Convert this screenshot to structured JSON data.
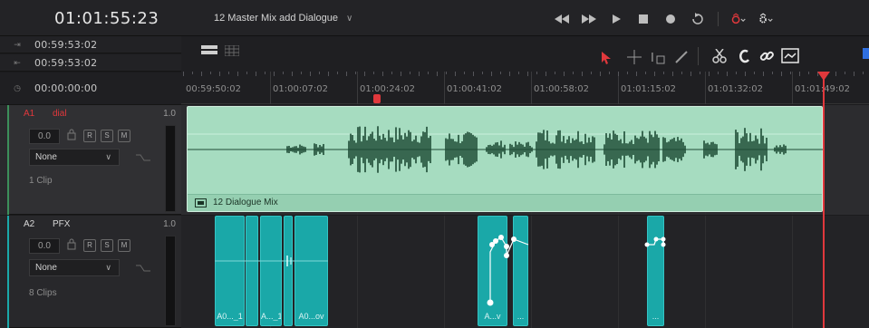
{
  "header": {
    "timecode": "01:01:55:23",
    "timeline_name": "12 Master Mix add Dialogue",
    "dropdown_glyph": "∨"
  },
  "timecodes": [
    {
      "icon": "⇥",
      "value": "00:59:53:02"
    },
    {
      "icon": "⇤",
      "value": "00:59:53:02"
    },
    {
      "icon": "◷",
      "value": "00:00:00:00"
    }
  ],
  "ruler": {
    "labels": [
      "00:59:50:02",
      "01:00:07:02",
      "01:00:24:02",
      "01:00:41:02",
      "01:00:58:02",
      "01:01:15:02",
      "01:01:32:02",
      "01:01:49:02"
    ]
  },
  "tracks": [
    {
      "id": "A1",
      "name": "dial",
      "volume": "1.0",
      "fader": "0.0",
      "buttons": [
        "R",
        "S",
        "M"
      ],
      "bus": "None",
      "clip_count": "1 Clip"
    },
    {
      "id": "A2",
      "name": "PFX",
      "volume": "1.0",
      "fader": "0.0",
      "buttons": [
        "R",
        "S",
        "M"
      ],
      "bus": "None",
      "clip_count": "8 Clips"
    }
  ],
  "audio_clip": {
    "label": "12 Dialogue Mix"
  },
  "pfx_clips": [
    {
      "label": "A0..._1"
    },
    {
      "label": "A..._1"
    },
    {
      "label": "A0...ov"
    },
    {
      "label": "A...v"
    },
    {
      "label": "..."
    },
    {
      "label": "..."
    }
  ],
  "colors": {
    "playhead": "#e0383c",
    "audio_clip": "#a6dcc0",
    "pfx_clip": "#1aa8a8",
    "track_a1_id": "#e0383c",
    "track_a1_accent": "#3c8f5a",
    "track_a2_accent": "#1aa8a8"
  }
}
